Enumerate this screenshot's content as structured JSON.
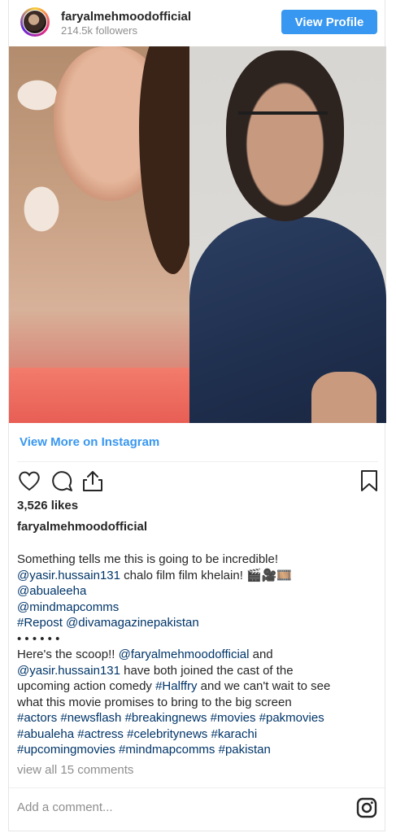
{
  "header": {
    "username": "faryalmehmoodofficial",
    "followers": "214.5k followers",
    "view_profile_label": "View Profile"
  },
  "colors": {
    "accent": "#3897f0",
    "link": "#003569",
    "muted": "#8e8e8e",
    "text": "#262626"
  },
  "media": {
    "view_more_label": "View More on Instagram"
  },
  "actions": {
    "icons": [
      "heart-icon",
      "comment-icon",
      "share-icon",
      "bookmark-icon"
    ]
  },
  "post": {
    "likes": "3,526 likes",
    "caption_username": "faryalmehmoodofficial",
    "caption_lines": [
      [
        {
          "t": "Something tells me this is going to be incredible!",
          "l": false
        }
      ],
      [
        {
          "t": "@yasir.hussain131",
          "l": true
        },
        {
          "t": " chalo film film khelain! 🎬🎥🎞️",
          "l": false
        }
      ],
      [
        {
          "t": "@abualeeha",
          "l": true
        }
      ],
      [
        {
          "t": "@mindmapcomms",
          "l": true
        }
      ],
      [
        {
          "t": "#Repost",
          "l": true
        },
        {
          "t": " ",
          "l": false
        },
        {
          "t": "@divamagazinepakistan",
          "l": true
        }
      ],
      [
        {
          "t": "• • • • • •",
          "l": false
        }
      ],
      [
        {
          "t": "Here's the scoop!! ",
          "l": false
        },
        {
          "t": "@faryalmehmoodofficial",
          "l": true
        },
        {
          "t": " and",
          "l": false
        }
      ],
      [
        {
          "t": "@yasir.hussain131",
          "l": true
        },
        {
          "t": " have both joined the cast of the",
          "l": false
        }
      ],
      [
        {
          "t": "upcoming action comedy ",
          "l": false
        },
        {
          "t": "#Halffry",
          "l": true
        },
        {
          "t": " and we can't wait to see",
          "l": false
        }
      ],
      [
        {
          "t": "what this movie promises to bring to the big screen",
          "l": false
        }
      ],
      [
        {
          "t": "#actors #newsflash #breakingnews #movies #pakmovies",
          "l": true
        }
      ],
      [
        {
          "t": "#abualeha #actress #celebritynews #karachi",
          "l": true
        }
      ],
      [
        {
          "t": "#upcomingmovies #mindmapcomms #pakistan",
          "l": true
        }
      ]
    ],
    "view_comments": "view all 15 comments"
  },
  "comment": {
    "placeholder": "Add a comment..."
  }
}
